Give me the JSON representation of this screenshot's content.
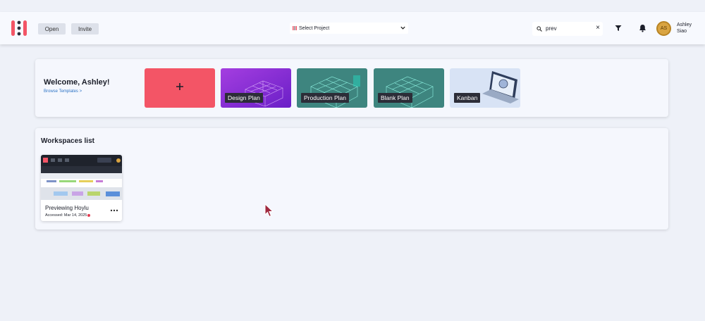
{
  "header": {
    "open_label": "Open",
    "invite_label": "Invite",
    "project_select": "Select Project",
    "search_value": "prev",
    "user_initials": "AS",
    "user_name": "Ashley Siao"
  },
  "welcome": {
    "title": "Welcome, Ashley!",
    "browse_link": "Browse Templates >",
    "templates": [
      {
        "label": "Design Plan"
      },
      {
        "label": "Production Plan"
      },
      {
        "label": "Blank Plan"
      },
      {
        "label": "Kanban"
      }
    ]
  },
  "workspaces": {
    "title": "Workspaces list",
    "cards": [
      {
        "name": "Previewing Hoylu",
        "accessed": "Accessed: Mar 14, 2025"
      }
    ]
  },
  "colors": {
    "brand_red": "#f35566",
    "accent_blue": "#2d74c6",
    "avatar_gold": "#d9a441"
  }
}
